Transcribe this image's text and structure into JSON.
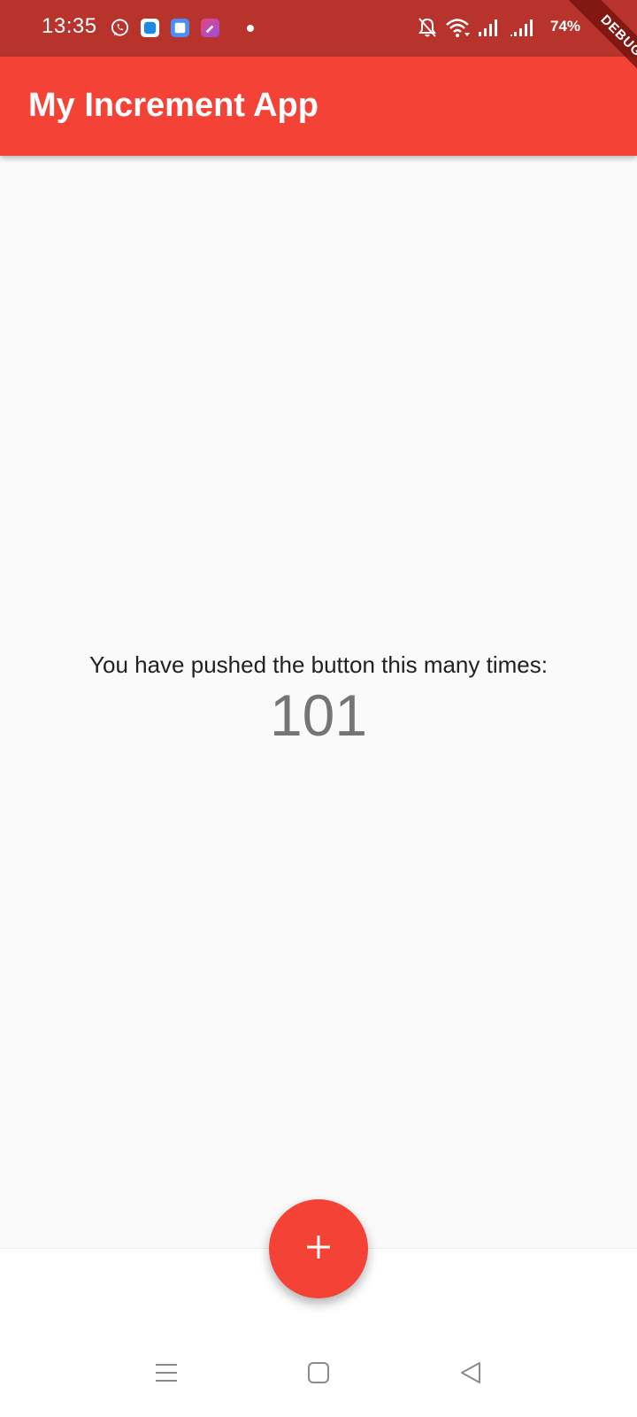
{
  "status_bar": {
    "time": "13:35",
    "battery_percent": "74%",
    "notification_icons": [
      "whatsapp-icon",
      "messenger-app-icon",
      "cloud-app-icon",
      "shortcut-app-icon"
    ],
    "system_icons": [
      "mute-bell-icon",
      "wifi-icon",
      "signal-icon",
      "signal-icon",
      "battery-icon"
    ]
  },
  "debug_banner": {
    "label": "DEBUG"
  },
  "app_bar": {
    "title": "My Increment App",
    "color": "#f44336"
  },
  "counter": {
    "caption": "You have pushed the button this many times:",
    "value": "101"
  },
  "fab": {
    "icon": "plus-icon",
    "color": "#f44336"
  },
  "nav_bar": {
    "buttons": [
      "menu-icon",
      "home-square-icon",
      "back-triangle-icon"
    ]
  }
}
